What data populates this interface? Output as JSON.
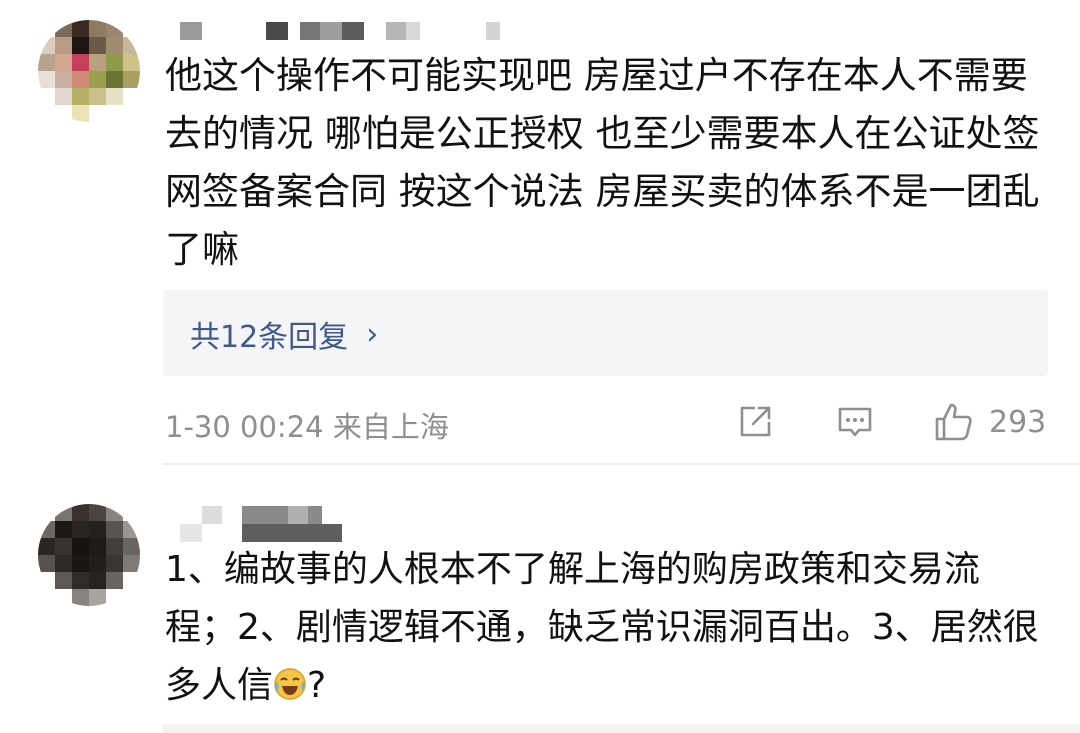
{
  "comments": [
    {
      "text": "他这个操作不可能实现吧 房屋过户不存在本人不需要去的情况 哪怕是公正授权 也至少需要本人在公证处签网签备案合同 按这个说法 房屋买卖的体系不是一团乱了嘛",
      "replies_label": "共12条回复",
      "replies_chevron": "›",
      "timestamp": "1-30 00:24",
      "location": "来自上海",
      "like_count": "293"
    },
    {
      "text_before_emoji": "1、编故事的人根本不了解上海的购房政策和交易流程；2、剧情逻辑不通，缺乏常识漏洞百出。3、居然很多人信",
      "emoji_name": "crying-laughing-emoji",
      "text_after_emoji": "?"
    }
  ],
  "icons": {
    "share": "share-icon",
    "comment": "comment-icon",
    "like": "thumbs-up-icon"
  },
  "colors": {
    "link": "#3d5a8a",
    "meta": "#8e8e93",
    "reply_bg": "#f5f5f7"
  }
}
